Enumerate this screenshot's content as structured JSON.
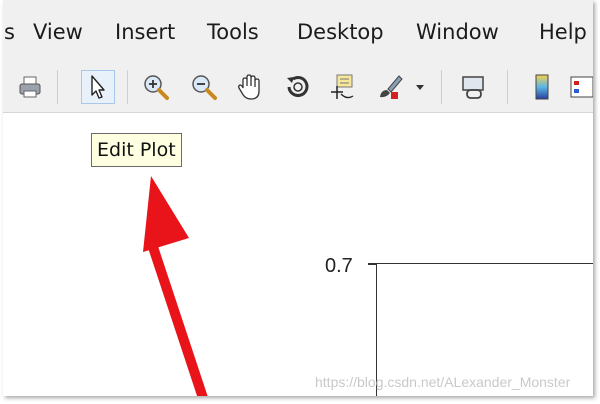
{
  "menu": {
    "items": [
      {
        "label": "View"
      },
      {
        "label": "Insert"
      },
      {
        "label": "Tools"
      },
      {
        "label": "Desktop"
      },
      {
        "label": "Window"
      },
      {
        "label": "Help"
      }
    ]
  },
  "toolbar": {
    "buttons": [
      {
        "icon": "print-icon"
      },
      {
        "icon": "edit-plot-arrow-icon",
        "active": true
      },
      {
        "icon": "zoom-in-icon"
      },
      {
        "icon": "zoom-out-icon"
      },
      {
        "icon": "pan-hand-icon"
      },
      {
        "icon": "rotate-3d-icon"
      },
      {
        "icon": "data-cursor-icon"
      },
      {
        "icon": "brush-icon"
      },
      {
        "icon": "dropdown-arrow-icon"
      },
      {
        "icon": "link-plot-icon"
      },
      {
        "icon": "colorbar-icon"
      },
      {
        "icon": "legend-icon"
      }
    ]
  },
  "tooltip": {
    "text": "Edit Plot"
  },
  "axes": {
    "y_tick_label": "0.7"
  },
  "watermark": {
    "text": "https://blog.csdn.net/ALexander_Monster"
  },
  "colors": {
    "arrow": "#e8141a",
    "tooltip_bg": "#ffffe1",
    "menubar_bg": "#f0f0f0"
  }
}
